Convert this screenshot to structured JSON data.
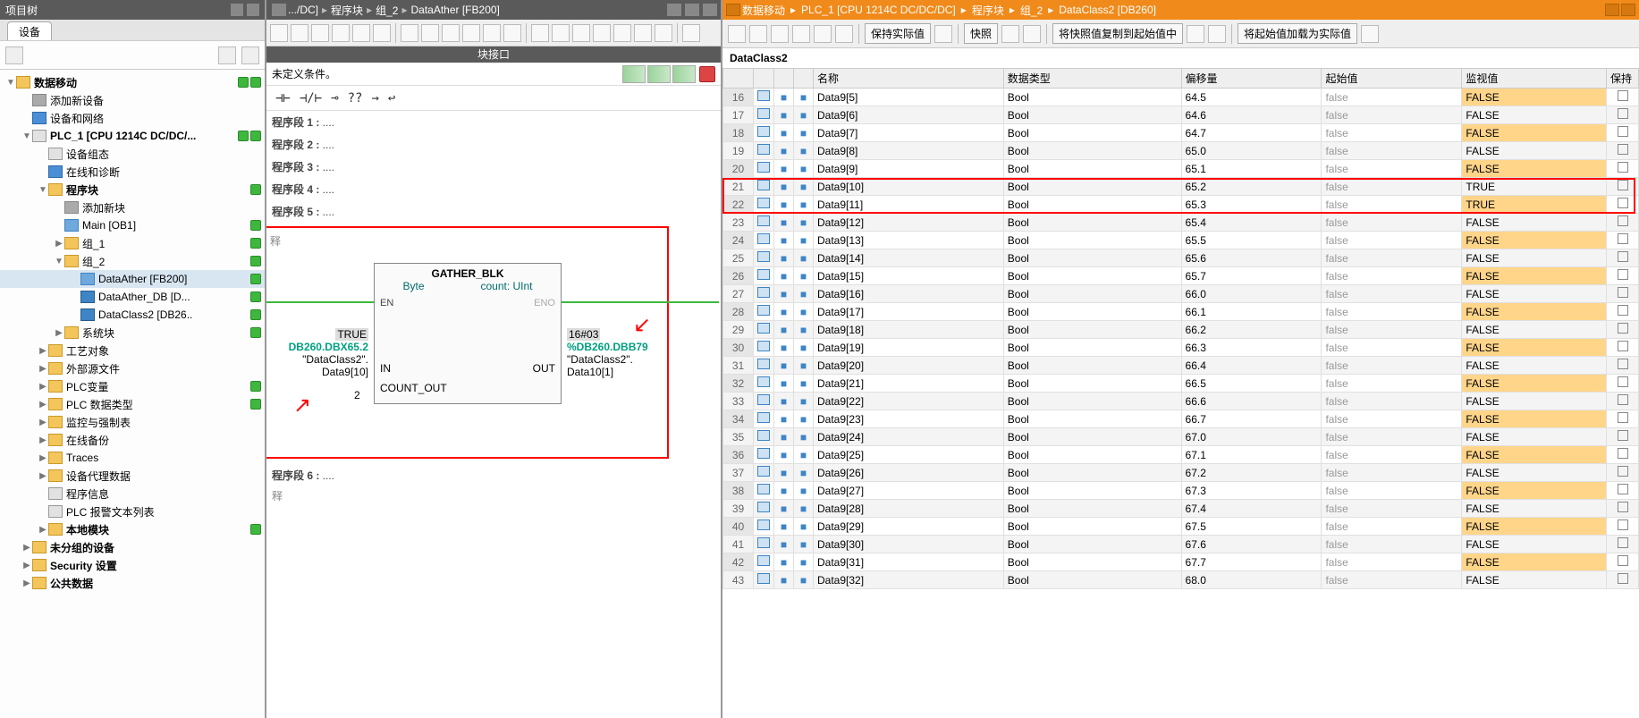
{
  "left": {
    "header": "项目树",
    "tab": "设备",
    "items": [
      {
        "depth": 0,
        "tog": "▼",
        "icon": "ic-folder",
        "label": "数据移动",
        "check": true,
        "dot": true,
        "bold": true
      },
      {
        "depth": 1,
        "tog": "",
        "icon": "ic-device",
        "label": "添加新设备"
      },
      {
        "depth": 1,
        "tog": "",
        "icon": "ic-blue",
        "label": "设备和网络"
      },
      {
        "depth": 1,
        "tog": "▼",
        "icon": "ic-plc",
        "label": "PLC_1 [CPU 1214C DC/DC/...",
        "check": true,
        "dot": true,
        "bold": true
      },
      {
        "depth": 2,
        "tog": "",
        "icon": "ic-plc",
        "label": "设备组态"
      },
      {
        "depth": 2,
        "tog": "",
        "icon": "ic-blue",
        "label": "在线和诊断"
      },
      {
        "depth": 2,
        "tog": "▼",
        "icon": "ic-folder",
        "label": "程序块",
        "dot": true,
        "bold": true
      },
      {
        "depth": 3,
        "tog": "",
        "icon": "ic-device",
        "label": "添加新块"
      },
      {
        "depth": 3,
        "tog": "",
        "icon": "ic-fb",
        "label": "Main [OB1]",
        "dot": true
      },
      {
        "depth": 3,
        "tog": "▶",
        "icon": "ic-folder",
        "label": "组_1",
        "dot": true
      },
      {
        "depth": 3,
        "tog": "▼",
        "icon": "ic-folder",
        "label": "组_2",
        "dot": true
      },
      {
        "depth": 4,
        "tog": "",
        "icon": "ic-fb",
        "label": "DataAther [FB200]",
        "dot": true,
        "selected": true
      },
      {
        "depth": 4,
        "tog": "",
        "icon": "ic-db",
        "label": "DataAther_DB [D...",
        "dot": true
      },
      {
        "depth": 4,
        "tog": "",
        "icon": "ic-db",
        "label": "DataClass2 [DB26..",
        "dot": true
      },
      {
        "depth": 3,
        "tog": "▶",
        "icon": "ic-folder",
        "label": "系统块",
        "dot": true
      },
      {
        "depth": 2,
        "tog": "▶",
        "icon": "ic-folder",
        "label": "工艺对象"
      },
      {
        "depth": 2,
        "tog": "▶",
        "icon": "ic-folder",
        "label": "外部源文件"
      },
      {
        "depth": 2,
        "tog": "▶",
        "icon": "ic-folder",
        "label": "PLC变量",
        "dot": true
      },
      {
        "depth": 2,
        "tog": "▶",
        "icon": "ic-folder",
        "label": "PLC 数据类型",
        "dot": true
      },
      {
        "depth": 2,
        "tog": "▶",
        "icon": "ic-folder",
        "label": "监控与强制表"
      },
      {
        "depth": 2,
        "tog": "▶",
        "icon": "ic-folder",
        "label": "在线备份"
      },
      {
        "depth": 2,
        "tog": "▶",
        "icon": "ic-folder",
        "label": "Traces"
      },
      {
        "depth": 2,
        "tog": "▶",
        "icon": "ic-folder",
        "label": "设备代理数据"
      },
      {
        "depth": 2,
        "tog": "",
        "icon": "ic-plc",
        "label": "程序信息"
      },
      {
        "depth": 2,
        "tog": "",
        "icon": "ic-plc",
        "label": "PLC 报警文本列表"
      },
      {
        "depth": 2,
        "tog": "▶",
        "icon": "ic-folder",
        "label": "本地模块",
        "check": true,
        "bold": true
      },
      {
        "depth": 1,
        "tog": "▶",
        "icon": "ic-folder",
        "label": "未分组的设备",
        "bold": true
      },
      {
        "depth": 1,
        "tog": "▶",
        "icon": "ic-folder",
        "label": "Security 设置",
        "bold": true
      },
      {
        "depth": 1,
        "tog": "▶",
        "icon": "ic-folder",
        "label": "公共数据",
        "bold": true
      }
    ]
  },
  "middle": {
    "crumbs": [
      ".../DC]",
      "程序块",
      "组_2",
      "DataAther [FB200]"
    ],
    "iface": "块接口",
    "cond": "未定义条件。",
    "networks": [
      "程序段 1 :",
      "程序段 2 :",
      "程序段 3 :",
      "程序段 4 :",
      "程序段 5 :",
      "程序段 6 :"
    ],
    "ladder_tools": [
      "⊣⊢",
      "⊣/⊢",
      "⊸",
      "??",
      "→",
      "↩"
    ],
    "gather": {
      "title": "GATHER_BLK",
      "sub_left": "Byte",
      "sub_right": "count:  UInt",
      "en": "EN",
      "eno": "ENO",
      "in": "IN",
      "out": "OUT",
      "count_out": "COUNT_OUT"
    },
    "in_vals": {
      "true_tag": "TRUE",
      "addr": "DB260.DBX65.2",
      "sym1": "\"DataClass2\".",
      "sym2": "Data9[10]",
      "count_val": "2"
    },
    "out_vals": {
      "hex": "16#03",
      "addr": "%DB260.DBB79",
      "sym1": "\"DataClass2\".",
      "sym2": "Data10[1]"
    },
    "comment": "释"
  },
  "right": {
    "crumbs": [
      "数据移动",
      "PLC_1 [CPU 1214C DC/DC/DC]",
      "程序块",
      "组_2",
      "DataClass2 [DB260]"
    ],
    "blockname": "DataClass2",
    "btns": {
      "keep": "保持实际值",
      "snap": "快照",
      "copy_snap": "将快照值复制到起始值中",
      "load_start": "将起始值加载为实际值"
    },
    "cols": {
      "name": "名称",
      "type": "数据类型",
      "offset": "偏移量",
      "start": "起始值",
      "monitor": "监视值",
      "keep": "保持"
    },
    "rows": [
      {
        "n": 16,
        "name": "Data9[5]",
        "type": "Bool",
        "off": "64.5",
        "start": "false",
        "mon": "FALSE"
      },
      {
        "n": 17,
        "name": "Data9[6]",
        "type": "Bool",
        "off": "64.6",
        "start": "false",
        "mon": "FALSE"
      },
      {
        "n": 18,
        "name": "Data9[7]",
        "type": "Bool",
        "off": "64.7",
        "start": "false",
        "mon": "FALSE"
      },
      {
        "n": 19,
        "name": "Data9[8]",
        "type": "Bool",
        "off": "65.0",
        "start": "false",
        "mon": "FALSE"
      },
      {
        "n": 20,
        "name": "Data9[9]",
        "type": "Bool",
        "off": "65.1",
        "start": "false",
        "mon": "FALSE"
      },
      {
        "n": 21,
        "name": "Data9[10]",
        "type": "Bool",
        "off": "65.2",
        "start": "false",
        "mon": "TRUE",
        "hl": true
      },
      {
        "n": 22,
        "name": "Data9[11]",
        "type": "Bool",
        "off": "65.3",
        "start": "false",
        "mon": "TRUE",
        "hl": true
      },
      {
        "n": 23,
        "name": "Data9[12]",
        "type": "Bool",
        "off": "65.4",
        "start": "false",
        "mon": "FALSE"
      },
      {
        "n": 24,
        "name": "Data9[13]",
        "type": "Bool",
        "off": "65.5",
        "start": "false",
        "mon": "FALSE"
      },
      {
        "n": 25,
        "name": "Data9[14]",
        "type": "Bool",
        "off": "65.6",
        "start": "false",
        "mon": "FALSE"
      },
      {
        "n": 26,
        "name": "Data9[15]",
        "type": "Bool",
        "off": "65.7",
        "start": "false",
        "mon": "FALSE"
      },
      {
        "n": 27,
        "name": "Data9[16]",
        "type": "Bool",
        "off": "66.0",
        "start": "false",
        "mon": "FALSE"
      },
      {
        "n": 28,
        "name": "Data9[17]",
        "type": "Bool",
        "off": "66.1",
        "start": "false",
        "mon": "FALSE"
      },
      {
        "n": 29,
        "name": "Data9[18]",
        "type": "Bool",
        "off": "66.2",
        "start": "false",
        "mon": "FALSE"
      },
      {
        "n": 30,
        "name": "Data9[19]",
        "type": "Bool",
        "off": "66.3",
        "start": "false",
        "mon": "FALSE"
      },
      {
        "n": 31,
        "name": "Data9[20]",
        "type": "Bool",
        "off": "66.4",
        "start": "false",
        "mon": "FALSE"
      },
      {
        "n": 32,
        "name": "Data9[21]",
        "type": "Bool",
        "off": "66.5",
        "start": "false",
        "mon": "FALSE"
      },
      {
        "n": 33,
        "name": "Data9[22]",
        "type": "Bool",
        "off": "66.6",
        "start": "false",
        "mon": "FALSE"
      },
      {
        "n": 34,
        "name": "Data9[23]",
        "type": "Bool",
        "off": "66.7",
        "start": "false",
        "mon": "FALSE"
      },
      {
        "n": 35,
        "name": "Data9[24]",
        "type": "Bool",
        "off": "67.0",
        "start": "false",
        "mon": "FALSE"
      },
      {
        "n": 36,
        "name": "Data9[25]",
        "type": "Bool",
        "off": "67.1",
        "start": "false",
        "mon": "FALSE"
      },
      {
        "n": 37,
        "name": "Data9[26]",
        "type": "Bool",
        "off": "67.2",
        "start": "false",
        "mon": "FALSE"
      },
      {
        "n": 38,
        "name": "Data9[27]",
        "type": "Bool",
        "off": "67.3",
        "start": "false",
        "mon": "FALSE"
      },
      {
        "n": 39,
        "name": "Data9[28]",
        "type": "Bool",
        "off": "67.4",
        "start": "false",
        "mon": "FALSE"
      },
      {
        "n": 40,
        "name": "Data9[29]",
        "type": "Bool",
        "off": "67.5",
        "start": "false",
        "mon": "FALSE"
      },
      {
        "n": 41,
        "name": "Data9[30]",
        "type": "Bool",
        "off": "67.6",
        "start": "false",
        "mon": "FALSE"
      },
      {
        "n": 42,
        "name": "Data9[31]",
        "type": "Bool",
        "off": "67.7",
        "start": "false",
        "mon": "FALSE"
      },
      {
        "n": 43,
        "name": "Data9[32]",
        "type": "Bool",
        "off": "68.0",
        "start": "false",
        "mon": "FALSE"
      }
    ]
  }
}
